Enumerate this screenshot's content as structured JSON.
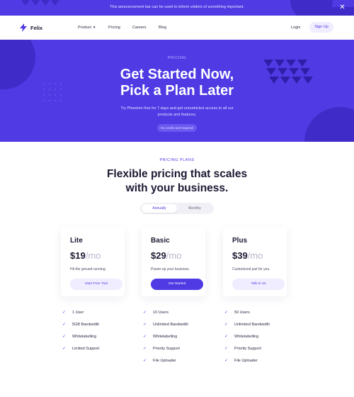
{
  "announcement": {
    "text": "This announcement bar can be used to inform visitors of something important.",
    "close_icon": "close-icon"
  },
  "nav": {
    "brand": "Felix",
    "logo_icon": "bolt-icon",
    "links": {
      "product": "Product",
      "pricing": "Pricing",
      "careers": "Careers",
      "blog": "Blog"
    },
    "login": "Login",
    "signup": "Sign Up"
  },
  "hero": {
    "eyebrow": "PRICING",
    "title_line1": "Get Started Now,",
    "title_line2": "Pick a Plan Later",
    "subtitle": "Try Phantom free for 7 days and get unrestricted access to all our products and features.",
    "pill": "No credit card required"
  },
  "plans_section": {
    "eyebrow": "PRICING PLANS",
    "title_line1": "Flexible pricing that scales",
    "title_line2": "with your business.",
    "toggle": {
      "annually": "Annually",
      "monthly": "Monthly"
    }
  },
  "plans": [
    {
      "name": "Lite",
      "price": "$19",
      "period": "/mo",
      "description": "Hit the ground running.",
      "cta": "Start Free Trial",
      "features": [
        "1 User",
        "5GB Bandwidth",
        "Whitelabelling",
        "Limited Support"
      ]
    },
    {
      "name": "Basic",
      "price": "$29",
      "period": "/mo",
      "description": "Power-up your business.",
      "cta": "Get Started",
      "features": [
        "10 Users",
        "Unlimited Bandwidth",
        "Whitelabelling",
        "Priority Support",
        "File Uploader"
      ]
    },
    {
      "name": "Plus",
      "price": "$39",
      "period": "/mo",
      "description": "Customized just for you.",
      "cta": "Talk to Us",
      "features": [
        "50 Users",
        "Unlimited Bandwidth",
        "Whitelabelling",
        "Priority Support",
        "File Uploader"
      ]
    }
  ],
  "colors": {
    "brand": "#4f3ae4",
    "brand_dark": "#3f2bc8",
    "brand_light": "#efedff",
    "text": "#1c1a33"
  }
}
